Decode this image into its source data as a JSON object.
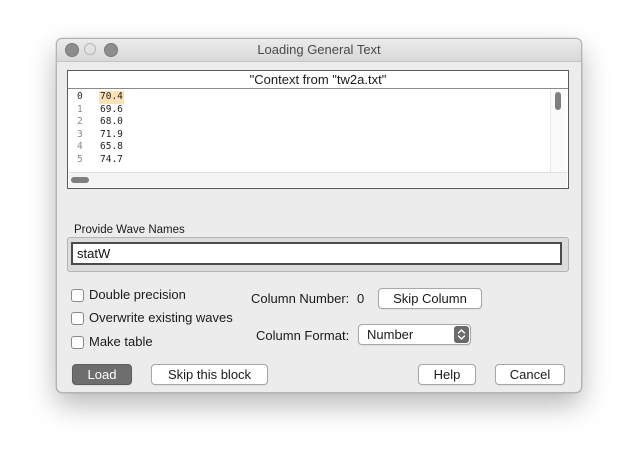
{
  "window": {
    "title": "Loading General Text"
  },
  "context": {
    "header": "\"Context from \"tw2a.txt\"",
    "rows": [
      {
        "index": "0",
        "value": "70.4"
      },
      {
        "index": "1",
        "value": "69.6"
      },
      {
        "index": "2",
        "value": "68.0"
      },
      {
        "index": "3",
        "value": "71.9"
      },
      {
        "index": "4",
        "value": "65.8"
      },
      {
        "index": "5",
        "value": "74.7"
      }
    ]
  },
  "wave_names": {
    "label": "Provide Wave Names",
    "value": "statW"
  },
  "options": {
    "double_precision": {
      "label": "Double precision",
      "checked": false
    },
    "overwrite": {
      "label": "Overwrite existing waves",
      "checked": false
    },
    "make_table": {
      "label": "Make table",
      "checked": false
    }
  },
  "column": {
    "number_label": "Column Number:",
    "number_value": "0",
    "skip_label": "Skip Column",
    "format_label": "Column Format:",
    "format_value": "Number"
  },
  "buttons": {
    "load": "Load",
    "skip_block": "Skip this block",
    "help": "Help",
    "cancel": "Cancel"
  },
  "colors": {
    "selected_row_bg": "#fbe2b6",
    "primary_button": "#6e6e6e"
  }
}
